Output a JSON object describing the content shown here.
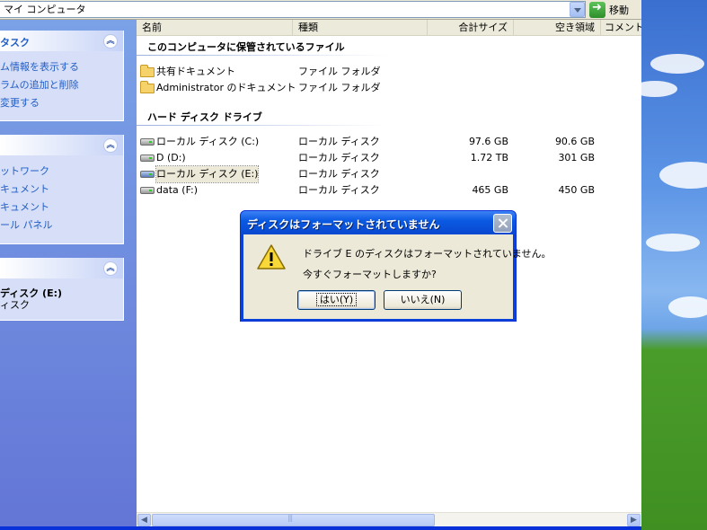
{
  "address_bar": {
    "path": "マイ コンピュータ",
    "go_label": "移動"
  },
  "task_pane": {
    "system_tasks": {
      "title": "タスク",
      "links": [
        "ム情報を表示する",
        "ラムの追加と削除",
        "変更する"
      ]
    },
    "other_places": {
      "title": "",
      "links": [
        "ットワーク",
        "キュメント",
        "キュメント",
        "ール パネル"
      ]
    },
    "details": {
      "title": "",
      "drive_name": "ディスク (E:)",
      "drive_type": "ィスク"
    }
  },
  "columns": {
    "name": "名前",
    "type": "種類",
    "total_size": "合計サイズ",
    "free_space": "空き領域",
    "comment": "コメント"
  },
  "groups": {
    "stored_files": {
      "title": "このコンピュータに保管されているファイル",
      "items": [
        {
          "name": "共有ドキュメント",
          "type": "ファイル フォルダ"
        },
        {
          "name": "Administrator のドキュメント",
          "type": "ファイル フォルダ"
        }
      ]
    },
    "hard_drives": {
      "title": "ハード ディスク ドライブ",
      "items": [
        {
          "name": "ローカル ディスク (C:)",
          "type": "ローカル ディスク",
          "total": "97.6 GB",
          "free": "90.6 GB"
        },
        {
          "name": "D (D:)",
          "type": "ローカル ディスク",
          "total": "1.72 TB",
          "free": "301 GB"
        },
        {
          "name": "ローカル ディスク (E:)",
          "type": "ローカル ディスク",
          "total": "",
          "free": ""
        },
        {
          "name": "data (F:)",
          "type": "ローカル ディスク",
          "total": "465 GB",
          "free": "450 GB"
        }
      ]
    }
  },
  "dialog": {
    "title": "ディスクはフォーマットされていません",
    "message_line1": "ドライブ E のディスクはフォーマットされていません。",
    "message_line2": "今すぐフォーマットしますか?",
    "yes_label": "はい(Y)",
    "no_label": "いいえ(N)"
  },
  "icons": {
    "folder": "folder-icon",
    "drive": "hard-drive-icon",
    "warning": "warning-icon",
    "close": "close-icon",
    "go": "go-arrow-icon"
  },
  "colors": {
    "xp_blue_titlebar": "#0b5ae2",
    "task_link": "#215dc6",
    "task_pane_bg": "#6375d6"
  }
}
